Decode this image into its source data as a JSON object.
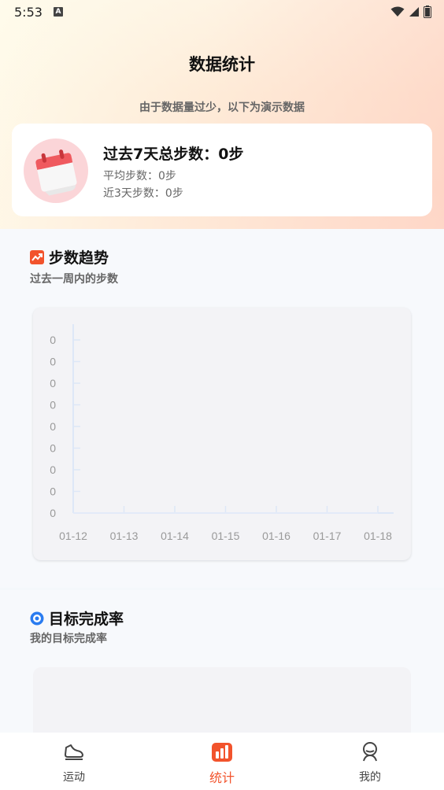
{
  "status_bar": {
    "time": "5:53",
    "indicator": "A"
  },
  "header": {
    "title": "数据统计",
    "notice": "由于数据量过少，以下为演示数据"
  },
  "summary": {
    "title": "过去7天总步数：0步",
    "avg": "平均步数：0步",
    "recent3": "近3天步数：0步",
    "icon": "calendar-icon"
  },
  "trend": {
    "title": "步数趋势",
    "subtitle": "过去一周内的步数",
    "icon": "trend-icon"
  },
  "goal": {
    "title": "目标完成率",
    "subtitle": "我的目标完成率",
    "icon": "target-icon"
  },
  "chart_data": {
    "type": "line",
    "categories": [
      "01-12",
      "01-13",
      "01-14",
      "01-15",
      "01-16",
      "01-17",
      "01-18"
    ],
    "values": [
      0,
      0,
      0,
      0,
      0,
      0,
      0
    ],
    "y_ticks": [
      "0",
      "0",
      "0",
      "0",
      "0",
      "0",
      "0",
      "0",
      "0"
    ],
    "title": "",
    "xlabel": "",
    "ylabel": ""
  },
  "tabs": [
    {
      "label": "运动",
      "icon": "shoe-icon",
      "active": false
    },
    {
      "label": "统计",
      "icon": "chart-bars-icon",
      "active": true
    },
    {
      "label": "我的",
      "icon": "profile-icon",
      "active": false
    }
  ],
  "colors": {
    "accent": "#f2532c",
    "chart_axis": "#dde7f7",
    "target_blue": "#2a7cf0"
  }
}
